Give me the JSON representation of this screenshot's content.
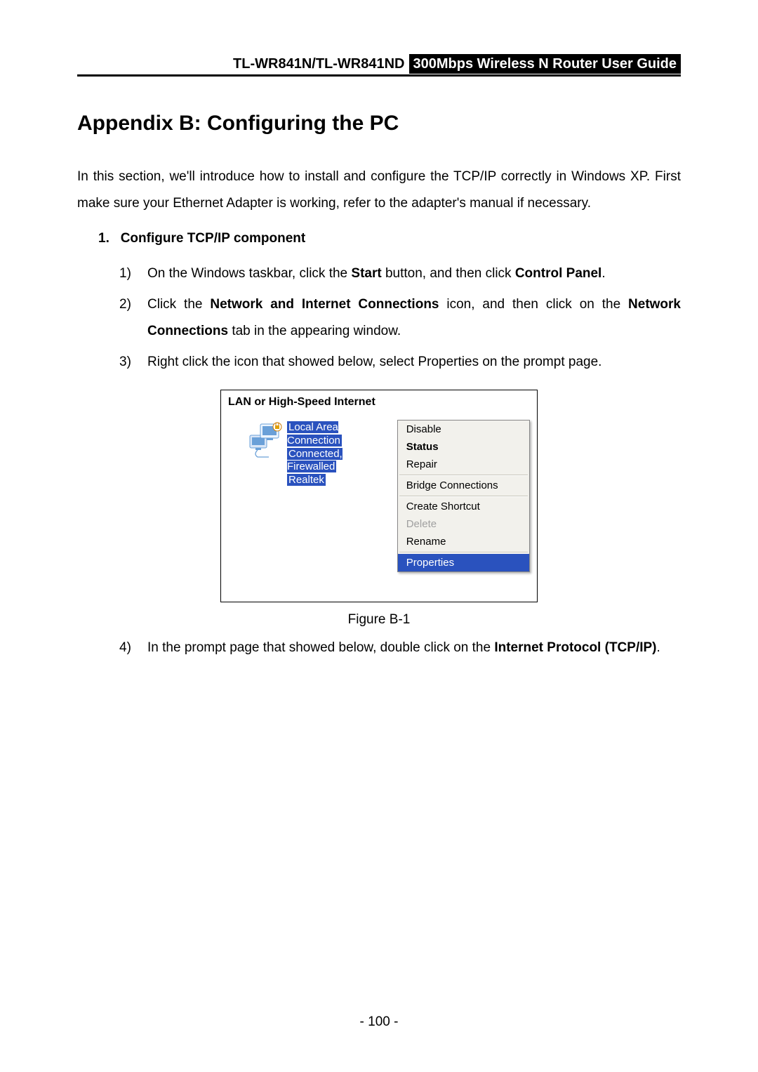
{
  "header": {
    "model": "TL-WR841N/TL-WR841ND",
    "guide": "300Mbps Wireless N Router User Guide"
  },
  "title": "Appendix B: Configuring the PC",
  "intro": "In this section, we'll introduce how to install and configure the TCP/IP correctly in Windows XP. First make sure your Ethernet Adapter is working, refer to the adapter's manual if necessary.",
  "section1": {
    "num": "1.",
    "heading": "Configure TCP/IP component"
  },
  "steps": {
    "s1": {
      "num": "1)",
      "pre": "On the Windows taskbar, click the ",
      "b1": "Start",
      "mid": " button, and then click ",
      "b2": "Control Panel",
      "post": "."
    },
    "s2": {
      "num": "2)",
      "pre": "Click the ",
      "b1": "Network and Internet Connections",
      "mid": " icon, and then click on the ",
      "b2": "Network Connections",
      "post": " tab in the appearing window."
    },
    "s3": {
      "num": "3)",
      "text": "Right click the icon that showed below, select Properties on the prompt page."
    },
    "s4": {
      "num": "4)",
      "pre": "In the prompt page that showed below, double click on the ",
      "b1": "Internet Protocol (TCP/IP)",
      "post": "."
    }
  },
  "figure": {
    "caption": "Figure B-1",
    "panel_title": "LAN or High-Speed Internet",
    "conn_name": "Local Area Connection",
    "conn_status": "Connected, Firewalled",
    "conn_adapter": "Realtek",
    "menu": {
      "disable": "Disable",
      "status": "Status",
      "repair": "Repair",
      "bridge": "Bridge Connections",
      "shortcut": "Create Shortcut",
      "delete": "Delete",
      "rename": "Rename",
      "properties": "Properties"
    }
  },
  "page_number": "- 100 -"
}
